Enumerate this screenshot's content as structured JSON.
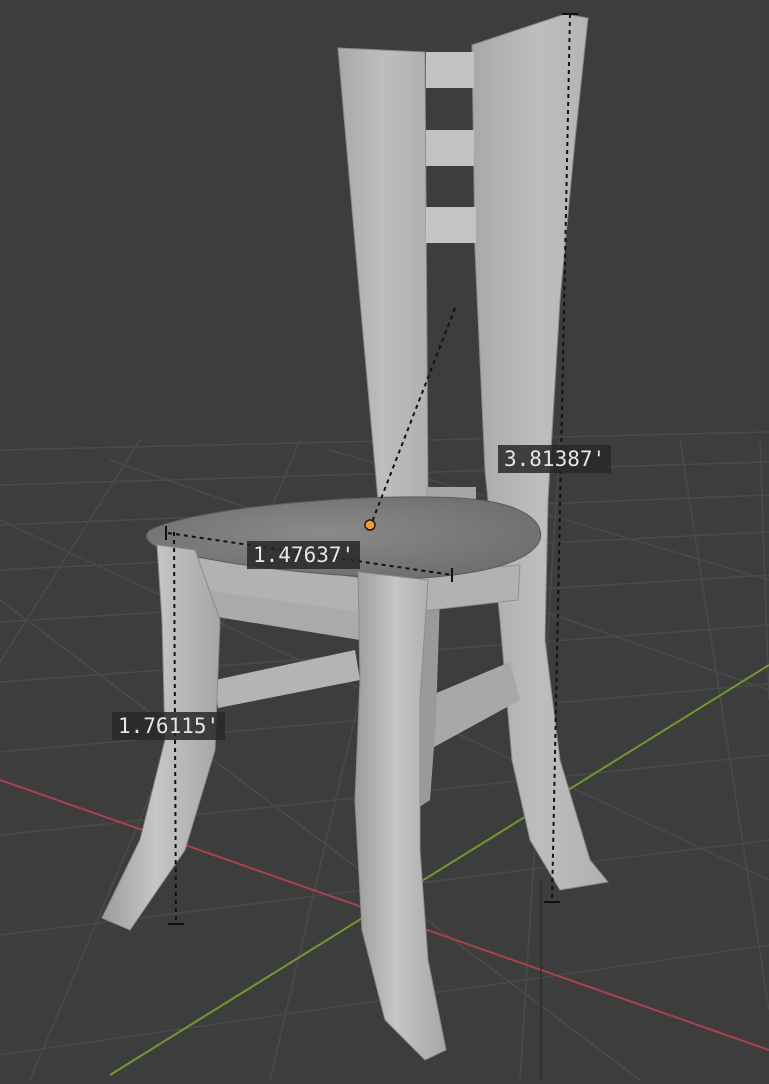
{
  "app": "3D viewport",
  "measurements": {
    "backrest_height": "3.81387'",
    "seat_width": "1.47637'",
    "leg_height": "1.76115'"
  },
  "colors": {
    "background": "#3d3d3d",
    "grid": "#4a4a4a",
    "x_axis": "#a8424e",
    "y_axis": "#6f9a2f",
    "model": "#b5b5b5",
    "origin_point": "#f0a030",
    "label_bg": "#282828"
  },
  "icons": {
    "origin": "origin-dot-icon"
  }
}
